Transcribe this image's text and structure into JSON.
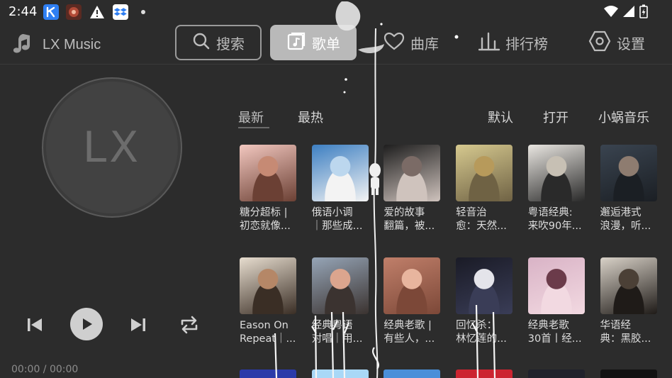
{
  "status": {
    "time": "2:44",
    "notifications": [
      {
        "icon": "k-app-icon",
        "color": "#2f7ff3"
      },
      {
        "icon": "avatar-app-icon",
        "color": "#7a3126"
      },
      {
        "icon": "warning-icon",
        "color": "#2c2c2c"
      },
      {
        "icon": "dropbox-icon",
        "color": "#ffffff"
      }
    ],
    "right_icons": [
      "wifi-icon",
      "signal-icon",
      "battery-charging-icon"
    ]
  },
  "app": {
    "name": "LX Music"
  },
  "nav": {
    "search": "搜索",
    "songlist": "歌单",
    "library": "曲库",
    "ranking": "排行榜",
    "settings": "设置"
  },
  "player": {
    "disc_text": "LX",
    "time": "00:00 / 00:00"
  },
  "subtabs": {
    "latest": "最新",
    "hot": "最热",
    "default": "默认",
    "open": "打开",
    "source": "小蜗音乐"
  },
  "songlists": [
    {
      "line1": "糖分超标 |",
      "line2": "初恋就像...",
      "colors": [
        "#f2c7bf",
        "#c68a74",
        "#6b4034"
      ]
    },
    {
      "line1": "俄语小调",
      "line2": "｜那些成...",
      "colors": [
        "#3d7fc2",
        "#bcd7ee",
        "#f3f3f3"
      ]
    },
    {
      "line1": "爱的故事",
      "line2": "翻篇，被...",
      "colors": [
        "#1e1e1e",
        "#7b6b66",
        "#cfc3bd"
      ]
    },
    {
      "line1": "轻音治",
      "line2": "愈：天然...",
      "colors": [
        "#d6c98f",
        "#b79a5b",
        "#6f6244"
      ]
    },
    {
      "line1": "粤语经典:",
      "line2": "来吹90年...",
      "colors": [
        "#e9e6e1",
        "#c7c0b4",
        "#2a2a2a"
      ]
    },
    {
      "line1": "邂逅港式",
      "line2": "浪漫，听...",
      "colors": [
        "#3a4450",
        "#8e7c70",
        "#1b1f24"
      ]
    },
    {
      "line1": "Eason On",
      "line2": "Repeat｜...",
      "colors": [
        "#e7ddcf",
        "#b58767",
        "#3a2e25"
      ]
    },
    {
      "line1": "经典粤语",
      "line2": "对唱｜用...",
      "colors": [
        "#96a5b7",
        "#dba58e",
        "#3b3330"
      ]
    },
    {
      "line1": "经典老歌 |",
      "line2": "有些人，...",
      "colors": [
        "#c07f6a",
        "#e8b59e",
        "#7c4838"
      ]
    },
    {
      "line1": "回忆杀：",
      "line2": "林忆莲的...",
      "colors": [
        "#1a1b26",
        "#e4e4ea",
        "#3a3d57"
      ]
    },
    {
      "line1": "经典老歌",
      "line2": "30首丨经...",
      "colors": [
        "#d9b3c6",
        "#6b3b4a",
        "#f2d9e1"
      ]
    },
    {
      "line1": "华语经",
      "line2": "典：黑胶...",
      "colors": [
        "#d9d2c8",
        "#4b4036",
        "#1f1b18"
      ]
    }
  ],
  "bottom_row_colors": [
    "#2b3aa9",
    "#a9d8f7",
    "#4a8fd9",
    "#cc2430",
    "#20222c",
    "#121212"
  ]
}
